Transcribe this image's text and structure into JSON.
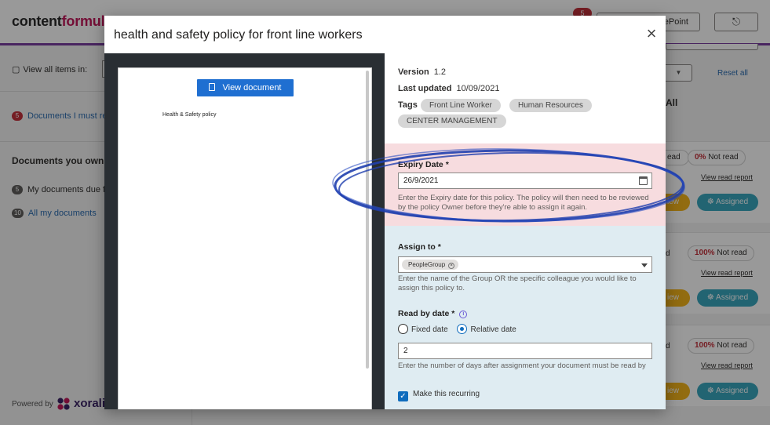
{
  "background": {
    "brand": {
      "part1": "content",
      "part2": "formul"
    },
    "notification_count": "5",
    "sharepoint_button": "ePoint",
    "exit_icon": "exit-icon",
    "view_all_label": "View all items in:",
    "docs_must_read": {
      "count": "5",
      "label": "Documents I must re"
    },
    "documents_you_own": "Documents you own",
    "docs_due": {
      "count": "5",
      "label": "My documents due f"
    },
    "all_my_docs": {
      "count": "10",
      "label": "All my documents"
    },
    "powered_by": "Powered by",
    "xoralia": "xoralia",
    "reset_all": "Reset all",
    "all_heading": "All",
    "cards": [
      {
        "left": "ead",
        "pct": "0%",
        "status": "Not read",
        "report": "View read report",
        "view": "iew",
        "assigned": "Assigned"
      },
      {
        "left": "d",
        "pct": "100%",
        "status": "Not read",
        "report": "View read report",
        "view": "iew",
        "assigned": "Assigned"
      },
      {
        "left": "d",
        "pct": "100%",
        "status": "Not read",
        "report": "View read report",
        "view": "iew",
        "assigned": "Assigned"
      }
    ]
  },
  "modal": {
    "title": "health and safety policy for front line workers",
    "close_icon": "×",
    "viewer": {
      "view_button": "View document",
      "document_text": "Health & Safety policy"
    },
    "version_label": "Version",
    "version": "1.2",
    "last_updated_label": "Last updated",
    "last_updated": "10/09/2021",
    "tags_label": "Tags",
    "tags": [
      "Front Line Worker",
      "Human Resources",
      "CENTER MANAGEMENT"
    ],
    "expiry": {
      "label": "Expiry Date *",
      "value": "26/9/2021",
      "help": "Enter the Expiry date for this policy. The policy will then need to be reviewed by the policy Owner before they're able to assign it again."
    },
    "assign": {
      "label": "Assign to *",
      "chip": "PeopleGroup",
      "help": "Enter the name of the Group OR the specific colleague you would like to assign this policy to."
    },
    "read_by": {
      "label": "Read by date *",
      "info_icon": "i",
      "options": [
        "Fixed date",
        "Relative date"
      ],
      "selected": "Relative date",
      "days_value": "2",
      "help": "Enter the number of days after assignment your document must be read by"
    },
    "recurring": {
      "label": "Make this recurring",
      "checked": true
    }
  },
  "colors": {
    "primary": "#1f6fd1",
    "expiry_bg": "#f7dcdf",
    "assign_bg": "#dfecf2",
    "annotation": "#1f3fae",
    "badge_red": "#c4313b",
    "assigned_teal": "#3aa7bf",
    "view_yellow": "#f3b51c"
  }
}
